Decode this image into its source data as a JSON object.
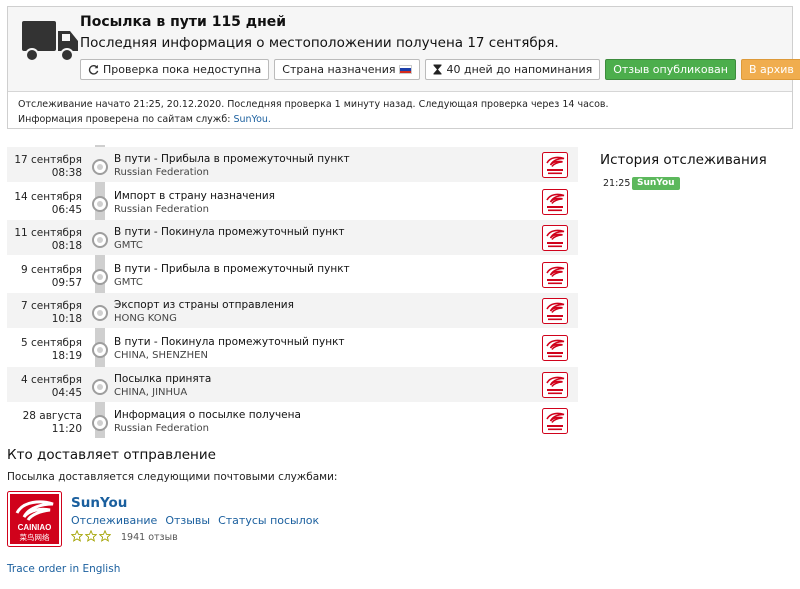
{
  "header": {
    "title": "Посылка в пути 115 дней",
    "subtitle": "Последняя информация о местоположении получена 17 сентября.",
    "buttons": {
      "check": "Проверка пока недоступна",
      "destination": "Страна назначения",
      "reminder": "40 дней до напоминания",
      "review": "Отзыв опубликован",
      "archive": "В архив",
      "close": "✕"
    },
    "info_line1": "Отслеживание начато 21:25, 20.12.2020. Последняя проверка 1 минуту назад. Следующая проверка через 14 часов.",
    "info_line2_prefix": "Информация проверена по сайтам служб:",
    "info_line2_link": "SunYou."
  },
  "events": [
    {
      "date": "17 сентября",
      "time": "08:38",
      "title": "В пути - Прибыла в промежуточный пункт",
      "location": "Russian Federation"
    },
    {
      "date": "14 сентября",
      "time": "06:45",
      "title": "Импорт в страну назначения",
      "location": "Russian Federation"
    },
    {
      "date": "11 сентября",
      "time": "08:18",
      "title": "В пути - Покинула промежуточный пункт",
      "location": "GMTC"
    },
    {
      "date": "9 сентября",
      "time": "09:57",
      "title": "В пути - Прибыла в промежуточный пункт",
      "location": "GMTC"
    },
    {
      "date": "7 сентября",
      "time": "10:18",
      "title": "Экспорт из страны отправления",
      "location": "HONG KONG"
    },
    {
      "date": "5 сентября",
      "time": "18:19",
      "title": "В пути - Покинула промежуточный пункт",
      "location": "CHINA, SHENZHEN"
    },
    {
      "date": "4 сентября",
      "time": "04:45",
      "title": "Посылка принята",
      "location": "CHINA, JINHUA"
    },
    {
      "date": "28 августа",
      "time": "11:20",
      "title": "Информация о посылке получена",
      "location": "Russian Federation"
    }
  ],
  "history": {
    "title": "История отслеживания",
    "time": "21:25",
    "badge": "SunYou"
  },
  "carriers": {
    "title": "Кто доставляет отправление",
    "subtitle": "Посылка доставляется следующими почтовыми службами:",
    "name": "SunYou",
    "links": [
      "Отслеживание",
      "Отзывы",
      "Статусы посылок"
    ],
    "rating_stars": 0,
    "reviews": "1941 отзыв",
    "logo_text": "CAINIAO",
    "logo_text_cn": "菜鸟网络"
  },
  "footer": {
    "trace_link": "Trace order in English"
  },
  "colors": {
    "accent_link": "#1a5f9e",
    "green": "#4cae4c",
    "orange": "#f0ad4e",
    "red": "#d9534f",
    "logo_red": "#d0021b"
  }
}
